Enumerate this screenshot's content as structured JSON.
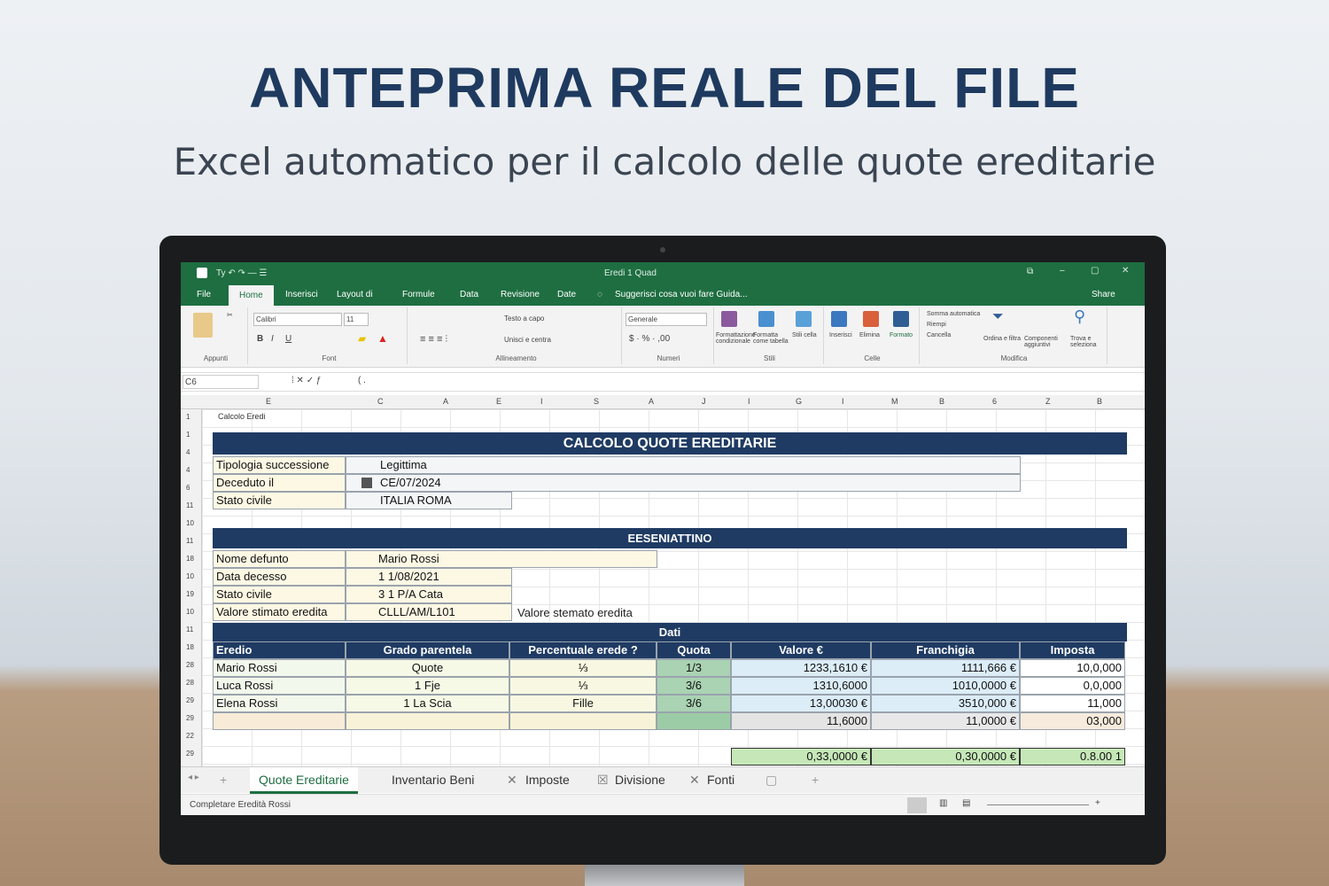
{
  "hero": {
    "title": "ANTEPRIMA REALE DEL FILE",
    "subtitle": "Excel automatico per il calcolo delle quote ereditarie"
  },
  "excel": {
    "window_title": "Eredi 1 Quad",
    "quick_access": "Ty ↶ ↷ — ☰",
    "share": "Share",
    "tabs": [
      "File",
      "Home",
      "Inserisci",
      "Layout di",
      "Formule",
      "Data",
      "Revisione",
      "Date"
    ],
    "search": "Suggerisci cosa vuoi fare Guida...",
    "ribbon": {
      "font_name": "Calibri",
      "font_size": "11",
      "number_format": "Generale",
      "wrap": "Testo a capo",
      "merge": "Unisci e centra",
      "groups": [
        "Appunti",
        "Font",
        "Allineamento",
        "Numeri",
        "Stili",
        "Celle",
        "Modifica"
      ],
      "styles": [
        "Formattazione condizionale",
        "Formatta come tabella",
        "Stili cella"
      ],
      "cells": [
        "Inserisci",
        "Elimina",
        "Formato"
      ],
      "edit": [
        "Somma automatica",
        "Riempi",
        "Cancella",
        "Ordina e filtra",
        "Trova e seleziona",
        "Componenti aggiuntivi"
      ]
    },
    "name_box": "C6",
    "formula": "(  .",
    "columns": [
      "E",
      "C",
      "A",
      "E",
      "I",
      "S",
      "A",
      "J",
      "I",
      "G",
      "I",
      "M",
      "B",
      "6",
      "Z",
      "B"
    ],
    "row_numbers": [
      "1",
      "1",
      "4",
      "4",
      "6",
      "11",
      "10",
      "11",
      "18",
      "10",
      "19",
      "10",
      "11",
      "18",
      "28",
      "28",
      "29",
      "29",
      "22",
      "29"
    ],
    "a1_text": "Calcolo Eredi",
    "section1": {
      "title": "CALCOLO QUOTE EREDITARIE",
      "rows": [
        {
          "label": "Tipologia successione",
          "value": "Legittima"
        },
        {
          "label": "Deceduto il",
          "value": "CE/07/2024"
        },
        {
          "label": "Stato civile",
          "value": "ITALIA ROMA"
        }
      ]
    },
    "section2": {
      "title": "EESENIATTINO",
      "rows": [
        {
          "label": "Nome defunto",
          "value": "Mario Rossi"
        },
        {
          "label": "Data decesso",
          "value": "1 1/08/2021"
        },
        {
          "label": "Stato civile",
          "value": "3 1 P/A Cata"
        },
        {
          "label": "Valore stimato eredita",
          "value": "CLLL/AM/L101"
        }
      ],
      "note": "Valore stemato eredita"
    },
    "section3": {
      "title": "Dati",
      "headers": [
        "Eredio",
        "Grado parentela",
        "Percentuale erede ?",
        "Quota",
        "Valore €",
        "Franchigia",
        "Imposta"
      ],
      "rows": [
        [
          "Mario Rossi",
          "Quote",
          "⅓",
          "1/3",
          "1233,1610 €",
          "1111,666 €",
          "10,0,000"
        ],
        [
          "Luca Rossi",
          "1 Fje",
          "⅓",
          "3/6",
          "1310,6000",
          "1010,0000 €",
          "0,0,000"
        ],
        [
          "Elena Rossi",
          "1 La Scia",
          "Fille",
          "3/6",
          "13,00030 €",
          "3510,000 €",
          "11,000"
        ],
        [
          "",
          "",
          "",
          "",
          "11,6000",
          "11,0000 €",
          "03,000"
        ]
      ],
      "totals": [
        "0,33,0000 €",
        "0,30,0000 €",
        "0.8.00 1"
      ]
    },
    "sheet_tabs": [
      "Quote Ereditarie",
      "Inventario Beni",
      "Imposte",
      "Divisione",
      "Fonti"
    ],
    "status_text": "Completare  Eredità Rossi"
  }
}
